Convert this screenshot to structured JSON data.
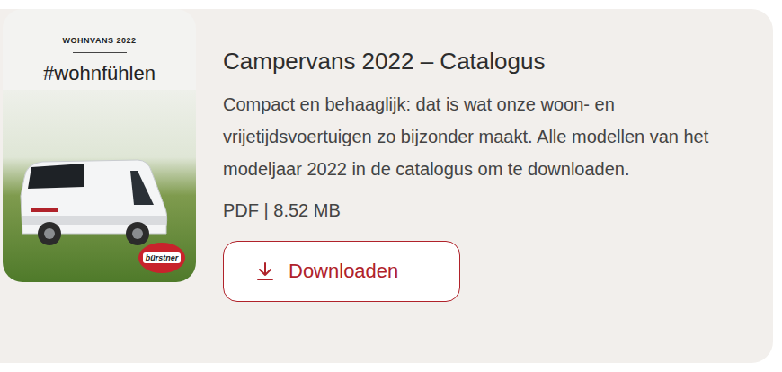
{
  "cover": {
    "kicker": "WOHNVANS 2022",
    "hashtag": "#wohnfühlen",
    "brand": "bürstner"
  },
  "title": "Campervans 2022 – Catalogus",
  "description": "Compact en behaaglijk: dat is wat onze woon- en vrijetijdsvoertuigen zo bijzonder maakt. Alle modellen van het modeljaar 2022 in de catalogus om te downloaden.",
  "file_info": "PDF | 8.52 MB",
  "button": {
    "label": "Downloaden"
  }
}
